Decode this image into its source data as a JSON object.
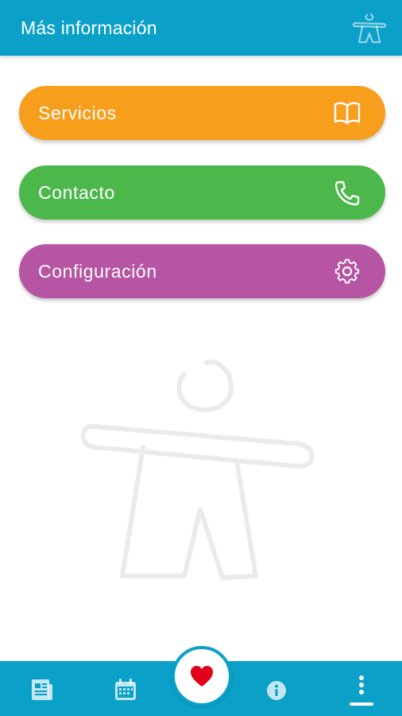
{
  "header": {
    "title": "Más información",
    "logo_icon": "person-logo-icon"
  },
  "menu": [
    {
      "label": "Servicios",
      "icon": "book-icon",
      "color": "#f79e1c"
    },
    {
      "label": "Contacto",
      "icon": "phone-icon",
      "color": "#4cb84c"
    },
    {
      "label": "Configuración",
      "icon": "gear-icon",
      "color": "#b655a3"
    }
  ],
  "bottom_nav": {
    "items": [
      {
        "icon": "news-icon"
      },
      {
        "icon": "calendar-icon"
      },
      {
        "icon": "heart-icon",
        "featured": true
      },
      {
        "icon": "info-icon"
      },
      {
        "icon": "more-icon",
        "active": true
      }
    ],
    "accent_color": "#0aa0c8",
    "heart_color": "#e3001b"
  }
}
